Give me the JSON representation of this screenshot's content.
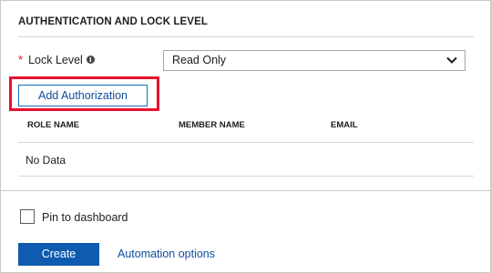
{
  "section": {
    "title": "AUTHENTICATION AND LOCK LEVEL"
  },
  "lock_level": {
    "label": "Lock Level",
    "required_marker": "*",
    "info_icon": "info-icon",
    "selected_value": "Read Only"
  },
  "authorization": {
    "add_button_label": "Add Authorization",
    "columns": [
      "ROLE NAME",
      "MEMBER NAME",
      "EMAIL"
    ],
    "empty_text": "No Data"
  },
  "footer": {
    "pin_label": "Pin to dashboard",
    "pin_checked": false,
    "create_label": "Create",
    "automation_label": "Automation options"
  },
  "colors": {
    "accent": "#0f5bb0",
    "link": "#0f4c9c",
    "required": "#e81123",
    "highlight": "#e8112d"
  }
}
